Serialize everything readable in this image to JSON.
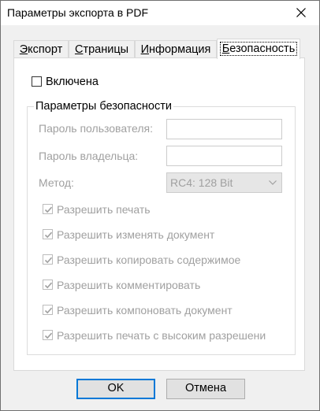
{
  "window": {
    "title": "Параметры экспорта в PDF"
  },
  "tabs": [
    {
      "label": "Экспорт",
      "mnemonic": "Э",
      "rest": "кспорт"
    },
    {
      "label": "Страницы",
      "mnemonic": "С",
      "rest": "траницы"
    },
    {
      "label": "Информация",
      "mnemonic": "И",
      "rest": "нформация"
    },
    {
      "label": "Безопасность",
      "mnemonic": "Б",
      "rest": "езопасность"
    }
  ],
  "security": {
    "enabled_label": "Включена",
    "enabled_checked": false,
    "group_title": "Параметры безопасности",
    "user_password_label": "Пароль пользователя:",
    "user_password_value": "",
    "owner_password_label": "Пароль владельца:",
    "owner_password_value": "",
    "method_label": "Метод:",
    "method_value": "RC4: 128 Bit",
    "permissions": [
      {
        "label": "Разрешить печать",
        "checked": true
      },
      {
        "label": "Разрешить изменять документ",
        "checked": true
      },
      {
        "label": "Разрешить копировать содержимое",
        "checked": true
      },
      {
        "label": "Разрешить комментировать",
        "checked": true
      },
      {
        "label": "Разрешить компоновать документ",
        "checked": true
      },
      {
        "label": "Разрешить печать с высоким разрешени",
        "checked": true
      }
    ]
  },
  "buttons": {
    "ok": "OK",
    "cancel": "Отмена"
  },
  "colors": {
    "accent": "#0078d7",
    "disabled_text": "#a0a0a0",
    "check_disabled": "#a0a0a0"
  }
}
